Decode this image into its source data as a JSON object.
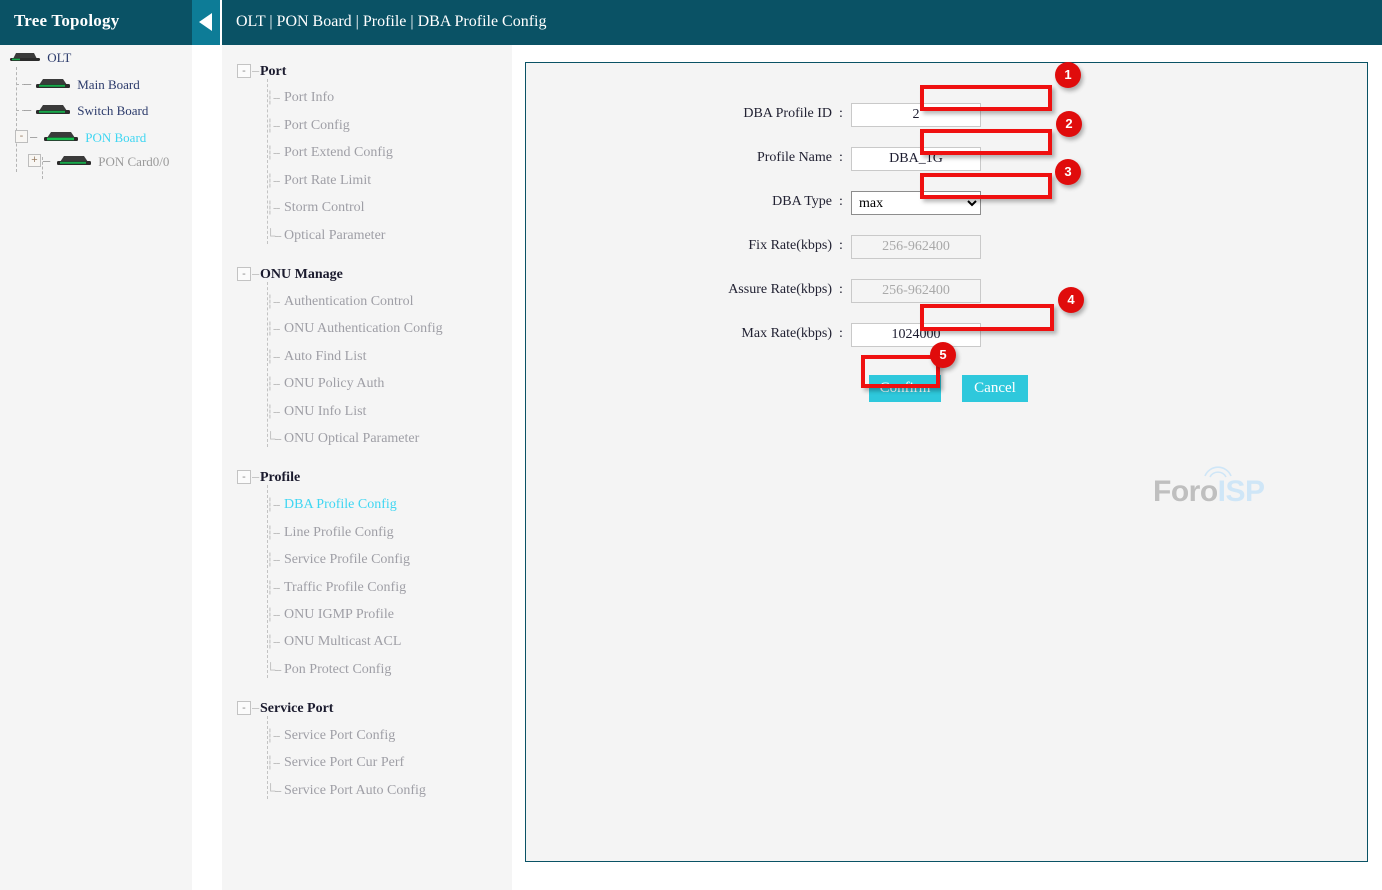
{
  "tree_panel": {
    "title": "Tree Topology",
    "collapse_icon": "chevron-left-icon",
    "nodes": [
      {
        "label": "OLT",
        "state": "normal",
        "expander": "",
        "icon": "device-icon"
      },
      {
        "label": "Main Board",
        "state": "normal",
        "expander": "",
        "icon": "device-icon"
      },
      {
        "label": "Switch Board",
        "state": "normal",
        "expander": "",
        "icon": "device-icon"
      },
      {
        "label": "PON Board",
        "state": "active",
        "expander": "-",
        "icon": "device-icon"
      },
      {
        "label": "PON Card0/0",
        "state": "muted",
        "expander": "+",
        "icon": "device-icon"
      }
    ]
  },
  "topbar": {
    "breadcrumb": "OLT | PON Board | Profile | DBA Profile Config"
  },
  "nav": {
    "groups": [
      {
        "label": "Port",
        "expander": "-",
        "items": [
          "Port Info",
          "Port Config",
          "Port Extend Config",
          "Port Rate Limit",
          "Storm Control",
          "Optical Parameter"
        ]
      },
      {
        "label": "ONU Manage",
        "expander": "-",
        "items": [
          "Authentication Control",
          "ONU Authentication Config",
          "Auto Find List",
          "ONU Policy Auth",
          "ONU Info List",
          "ONU Optical Parameter"
        ]
      },
      {
        "label": "Profile",
        "expander": "-",
        "items": [
          "DBA Profile Config",
          "Line Profile Config",
          "Service Profile Config",
          "Traffic Profile Config",
          "ONU IGMP Profile",
          "ONU Multicast ACL",
          "Pon Protect Config"
        ]
      },
      {
        "label": "Service Port",
        "expander": "-",
        "items": [
          "Service Port Config",
          "Service Port Cur Perf",
          "Service Port Auto Config"
        ]
      }
    ],
    "selected_item": "DBA Profile Config"
  },
  "form": {
    "fields": [
      {
        "label": "DBA Profile ID",
        "colon": ":",
        "type": "text",
        "value": "2",
        "placeholder": "",
        "disabled": false
      },
      {
        "label": "Profile Name",
        "colon": ":",
        "type": "text",
        "value": "DBA_1G",
        "placeholder": "",
        "disabled": false
      },
      {
        "label": "DBA Type",
        "colon": ":",
        "type": "select",
        "value": "max",
        "options": [
          "max"
        ],
        "disabled": false
      },
      {
        "label": "Fix Rate(kbps)",
        "colon": ":",
        "type": "text",
        "value": "",
        "placeholder": "256-962400",
        "disabled": true
      },
      {
        "label": "Assure Rate(kbps)",
        "colon": ":",
        "type": "text",
        "value": "",
        "placeholder": "256-962400",
        "disabled": true
      },
      {
        "label": "Max Rate(kbps)",
        "colon": ":",
        "type": "text",
        "value": "1024000",
        "placeholder": "",
        "disabled": false
      }
    ],
    "confirm_label": "Confirm",
    "cancel_label": "Cancel"
  },
  "annotations": {
    "badges": [
      "1",
      "2",
      "3",
      "4",
      "5"
    ],
    "highlight_color": "#ef1010",
    "badge_color": "#e00c0c"
  },
  "watermark": {
    "text_primary": "Foro",
    "text_secondary": "ISP",
    "icon": "signal-tower-icon"
  },
  "colors": {
    "header_teal": "#0a5265",
    "collapse_teal": "#0d7c97",
    "accent_cyan": "#2ec8dc",
    "link_cyan": "#3fd6f2",
    "panel_bg": "#f4f4f4"
  }
}
